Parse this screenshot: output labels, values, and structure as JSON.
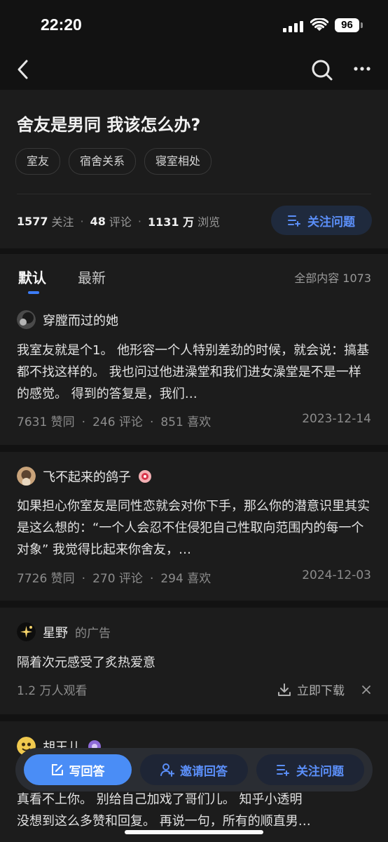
{
  "status": {
    "time": "22:20",
    "battery": "96"
  },
  "question": {
    "title": "舍友是男同 我该怎么办?",
    "tags": [
      "室友",
      "宿舍关系",
      "寝室相处"
    ],
    "stats": {
      "follow_count": "1577",
      "follow_label": "关注",
      "comment_count": "48",
      "comment_label": "评论",
      "view_count": "1131 万",
      "view_label": "浏览"
    },
    "follow_button": "关注问题"
  },
  "tabs": {
    "default": "默认",
    "latest": "最新",
    "all_count": "全部内容 1073"
  },
  "answers": [
    {
      "author": "穿膛而过的她",
      "excerpt": "我室友就是个1。 他形容一个人特别差劲的时候，就会说：搞基都不找这样的。 我也问过他进澡堂和我们进女澡堂是不是一样的感觉。 得到的答复是，我们…",
      "likes": "7631 赞同",
      "comments": "246 评论",
      "favs": "851 喜欢",
      "date": "2023-12-14"
    },
    {
      "author": "飞不起来的鸽子",
      "excerpt": "如果担心你室友是同性恋就会对你下手，那么你的潜意识里其实是这么想的：“一个人会忍不住侵犯自己性取向范围内的每一个对象” 我觉得比起来你舍友，…",
      "likes": "7726 赞同",
      "comments": "270 评论",
      "favs": "294 喜欢",
      "date": "2024-12-03"
    },
    {
      "author": "胡王儿",
      "excerpt_line2": "真看不上你。 别给自己加戏了哥们儿。 知乎小透明",
      "excerpt_line3": "没想到这么多赞和回复。 再说一句，所有的顺直男…"
    }
  ],
  "ad": {
    "advertiser": "星野",
    "suffix": "的广告",
    "title": "隔着次元感受了炙热爱意",
    "viewers": "1.2 万人观看",
    "download": "立即下载"
  },
  "bottom": {
    "write": "写回答",
    "invite": "邀请回答",
    "follow": "关注问题"
  },
  "colors": {
    "accent": "#5b8ff9",
    "primary_button": "#4a8df6",
    "background": "#121212",
    "card": "#1c1c1c"
  }
}
